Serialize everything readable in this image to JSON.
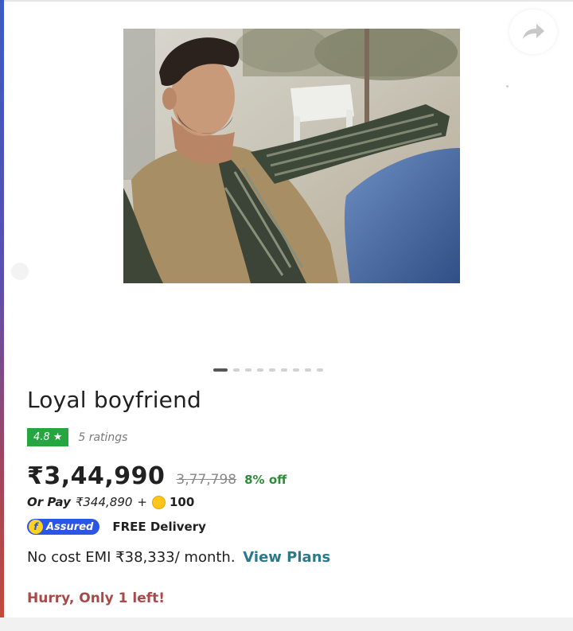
{
  "product": {
    "title": "Loyal boyfriend",
    "rating": {
      "score": "4.8",
      "star": "★",
      "count_text": "5 ratings",
      "badge_color": "#26a541"
    },
    "price": {
      "current": "₹3,44,990",
      "original": "3,77,798",
      "discount": "8% off"
    },
    "or_pay": {
      "label": "Or Pay",
      "amount": "₹344,890",
      "plus": "+",
      "coins": "100"
    },
    "assured": {
      "badge_label": "Assured",
      "free_delivery": "FREE Delivery"
    },
    "emi": {
      "text": "No cost EMI ₹38,333/ month.",
      "link": "View Plans"
    },
    "stock_message": "Hurry, Only 1 left!"
  },
  "carousel": {
    "total": 9,
    "active_index": 0
  },
  "icons": {
    "share": "share-arrow-icon",
    "coin": "supercoin-icon",
    "assured": "flipkart-f-icon"
  },
  "colors": {
    "accent_link": "#2b7a8c",
    "discount": "#2e8b3a",
    "urgency": "#a84a4a",
    "assured_blue": "#2a55e5"
  }
}
